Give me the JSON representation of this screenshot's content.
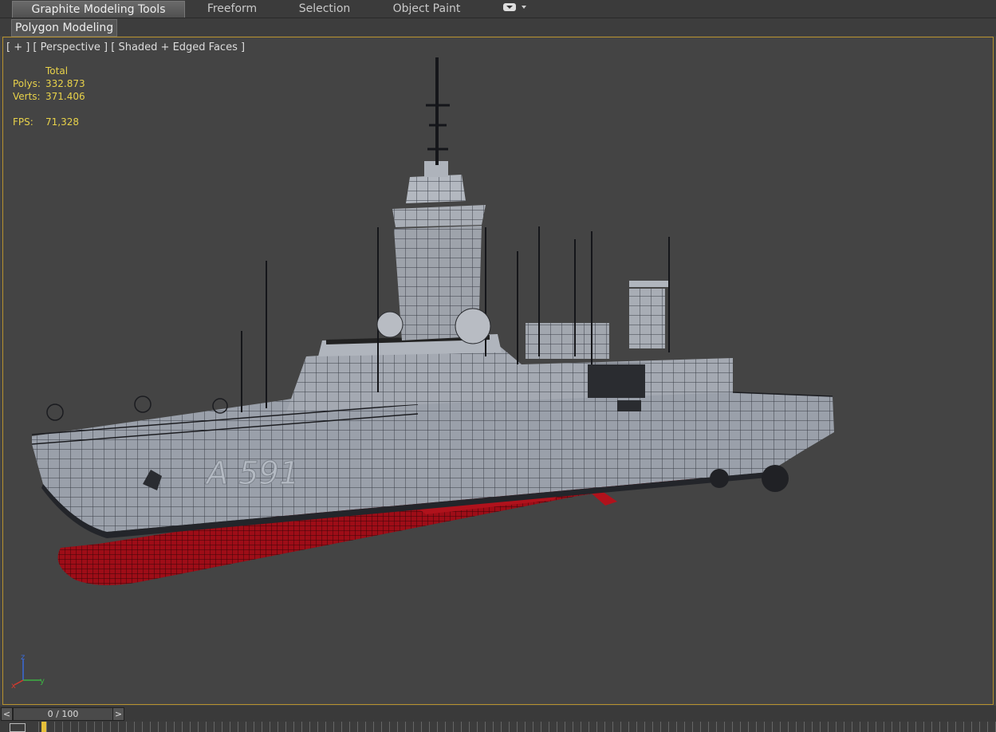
{
  "ribbon": {
    "tabs": [
      {
        "label": "Graphite Modeling Tools",
        "active": true
      },
      {
        "label": "Freeform",
        "active": false
      },
      {
        "label": "Selection",
        "active": false
      },
      {
        "label": "Object Paint",
        "active": false
      }
    ],
    "menu_icon": "dropdown-toggle-icon",
    "subtab_label": "Polygon Modeling"
  },
  "viewport": {
    "label": "[ + ] [ Perspective ] [ Shaded + Edged Faces ]",
    "stats": {
      "total_label": "Total",
      "polys_label": "Polys:",
      "polys_value": "332.873",
      "verts_label": "Verts:",
      "verts_value": "371.406",
      "fps_label": "FPS:",
      "fps_value": "71,328"
    },
    "hull_text": "A 591",
    "axis": {
      "x": "x",
      "y": "y",
      "z": "z"
    },
    "colors": {
      "border_active": "#b8922e",
      "stats_text": "#e8d24a",
      "hull": "#9aa0aa",
      "bottom": "#9e0d17"
    }
  },
  "timeline": {
    "frame_label": "0 / 100",
    "prev_label": "<",
    "next_label": ">"
  }
}
